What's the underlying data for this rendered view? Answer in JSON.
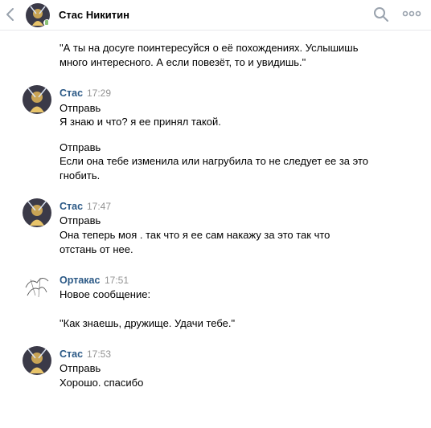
{
  "header": {
    "contact_name": "Стас Никитин",
    "back_icon": "chevron-left-icon",
    "search_icon": "search-icon",
    "more_icon": "more-horizontal-icon",
    "online_color": "#8ac176"
  },
  "messages": [
    {
      "sender": "",
      "time": "",
      "lines": [
        "\"А ты на досуге поинтересуйся о её похождениях. Услышишь",
        "много интересного. А если повезёт, то и увидишь.\""
      ]
    },
    {
      "sender": "Стас",
      "time": "17:29",
      "lines": [
        "Отправь",
        "Я знаю и что? я ее принял такой.",
        "",
        "Отправь",
        "Если она тебе изменила или нагрубила то не следует ее за это",
        "гнобить."
      ]
    },
    {
      "sender": "Стас",
      "time": "17:47",
      "lines": [
        "Отправь",
        "Она теперь моя . так что я ее сам накажу за это так что",
        "отстань от нее."
      ]
    },
    {
      "sender": "Ортакас",
      "time": "17:51",
      "lines": [
        "Новое сообщение:",
        "",
        "\"Как знаешь, дружище. Удачи тебе.\""
      ]
    },
    {
      "sender": "Стас",
      "time": "17:53",
      "lines": [
        "Отправь",
        "Хорошо. спасибо"
      ]
    }
  ],
  "colors": {
    "sender_name": "#2a5885",
    "timestamp": "#939393",
    "icon_gray": "#99a2ad"
  }
}
